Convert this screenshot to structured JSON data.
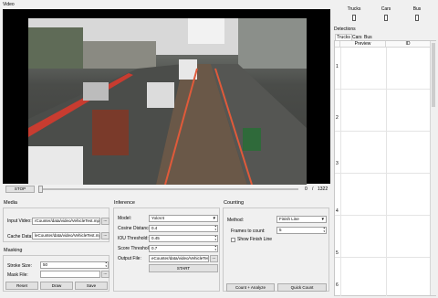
{
  "video": {
    "title": "Video",
    "stop_label": "STOP",
    "frame_current": "0",
    "frame_sep": "/",
    "frame_total": "1322"
  },
  "counters": {
    "items": [
      {
        "label": "Trucks",
        "value": "0"
      },
      {
        "label": "Cars",
        "value": "0"
      },
      {
        "label": "Bus",
        "value": "0"
      }
    ]
  },
  "detections": {
    "title": "Detections",
    "tabs": [
      "Trucks",
      "Cars",
      "Bus"
    ],
    "columns": [
      "Preview",
      "ID"
    ],
    "rows": [
      "1",
      "2",
      "3",
      "4",
      "5",
      "6"
    ]
  },
  "media": {
    "title": "Media",
    "input_video_label": "Input Video:",
    "input_video_value": "rCounter/data/video/VehicleTest.mp4",
    "cache_data_label": "Cache Data:",
    "cache_data_value": "leCounter/data/video/VehicleTest.mp4",
    "browse": "..."
  },
  "masking": {
    "title": "Masking",
    "stroke_label": "Stroke Size:",
    "stroke_value": "50",
    "mask_file_label": "Mask File:",
    "mask_file_value": "",
    "browse": "...",
    "reset": "Reset",
    "draw": "Draw",
    "save": "Save"
  },
  "inference": {
    "title": "Inference",
    "model_label": "Model:",
    "model_value": "YoloV4",
    "cosine_label": "Cosine Distance:",
    "cosine_value": "0.4",
    "iou_label": "IOU Threshold:",
    "iou_value": "0.45",
    "score_label": "Score Threshold:",
    "score_value": "0.7",
    "output_label": "Output File:",
    "output_value": "eCounter/data/video/VehicleTest",
    "browse": "...",
    "start": "START"
  },
  "counting": {
    "title": "Counting",
    "method_label": "Method:",
    "method_value": "Finish Line",
    "frames_label": "Frames to count:",
    "frames_value": "5",
    "show_finish_label": "Show Finish Line",
    "count_analyze": "Count + Analyze",
    "quick_count": "Quick Count"
  }
}
